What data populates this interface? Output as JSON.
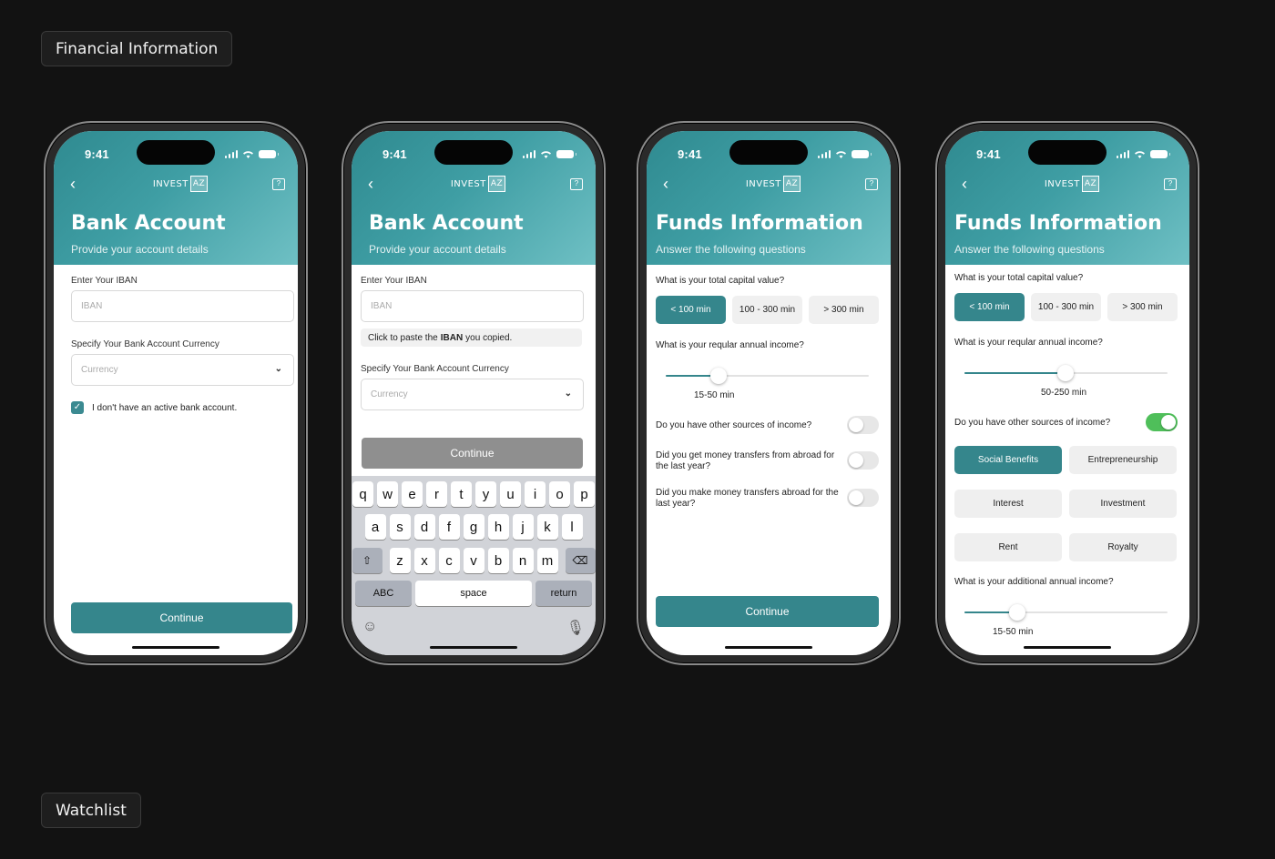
{
  "sections": {
    "top": "Financial Information",
    "bottom": "Watchlist"
  },
  "status_time": "9:41",
  "logo": {
    "text": "INVEST",
    "badge": "AZ"
  },
  "icons": {
    "back": "chevron-left-icon",
    "chat": "chat-help-icon"
  },
  "bank1": {
    "title": "Bank Account",
    "subtitle": "Provide your account details",
    "iban_label": "Enter Your IBAN",
    "iban_placeholder": "IBAN",
    "currency_label": "Specify Your Bank Account Currency",
    "currency_placeholder": "Currency",
    "checkbox_label": "I don't have an active bank account.",
    "continue": "Continue"
  },
  "bank2": {
    "title": "Bank Account",
    "subtitle": "Provide your account details",
    "iban_label": "Enter Your IBAN",
    "iban_placeholder": "IBAN",
    "hint_pre": "Click to paste the",
    "hint_bold": "IBAN",
    "hint_post": "you copied.",
    "currency_label": "Specify Your Bank Account Currency",
    "currency_placeholder": "Currency",
    "continue": "Continue",
    "keyboard": {
      "row1": [
        "q",
        "w",
        "e",
        "r",
        "t",
        "y",
        "u",
        "i",
        "o",
        "p"
      ],
      "row2": [
        "a",
        "s",
        "d",
        "f",
        "g",
        "h",
        "j",
        "k",
        "l"
      ],
      "row3": [
        "z",
        "x",
        "c",
        "v",
        "b",
        "n",
        "m"
      ],
      "abc": "ABC",
      "space": "space",
      "return": "return"
    }
  },
  "funds1": {
    "title": "Funds Information",
    "subtitle": "Answer the following questions",
    "q_capital": "What is your total capital value?",
    "capital_options": [
      "< 100 min",
      "100 - 300 min",
      "> 300 min"
    ],
    "capital_selected": 0,
    "q_income": "What is your reqular annual income?",
    "income_value": "15-50 min",
    "income_level": 0.25,
    "q_other": "Do you have other sources of income?",
    "q_transfers_in": "Did you get money transfers from abroad for the last year?",
    "q_transfers_out": "Did you make money transfers abroad for the last year?",
    "continue": "Continue"
  },
  "funds2": {
    "title": "Funds Information",
    "subtitle": "Answer the following questions",
    "q_capital": "What is your total capital value?",
    "capital_options": [
      "< 100 min",
      "100 - 300 min",
      "> 300 min"
    ],
    "capital_selected": 0,
    "q_income": "What is your reqular annual income?",
    "income_value": "50-250 min",
    "income_level": 0.5,
    "q_other": "Do you have other sources of income?",
    "sources": [
      "Social Benefits",
      "Entrepreneurship",
      "Interest",
      "Investment",
      "Rent",
      "Royalty"
    ],
    "q_additional": "What is your additional annual income?",
    "additional_value": "15-50 min",
    "additional_level": 0.25
  },
  "colors": {
    "accent": "#35868c",
    "toggle_on": "#4fbf5a",
    "background": "#121212"
  }
}
